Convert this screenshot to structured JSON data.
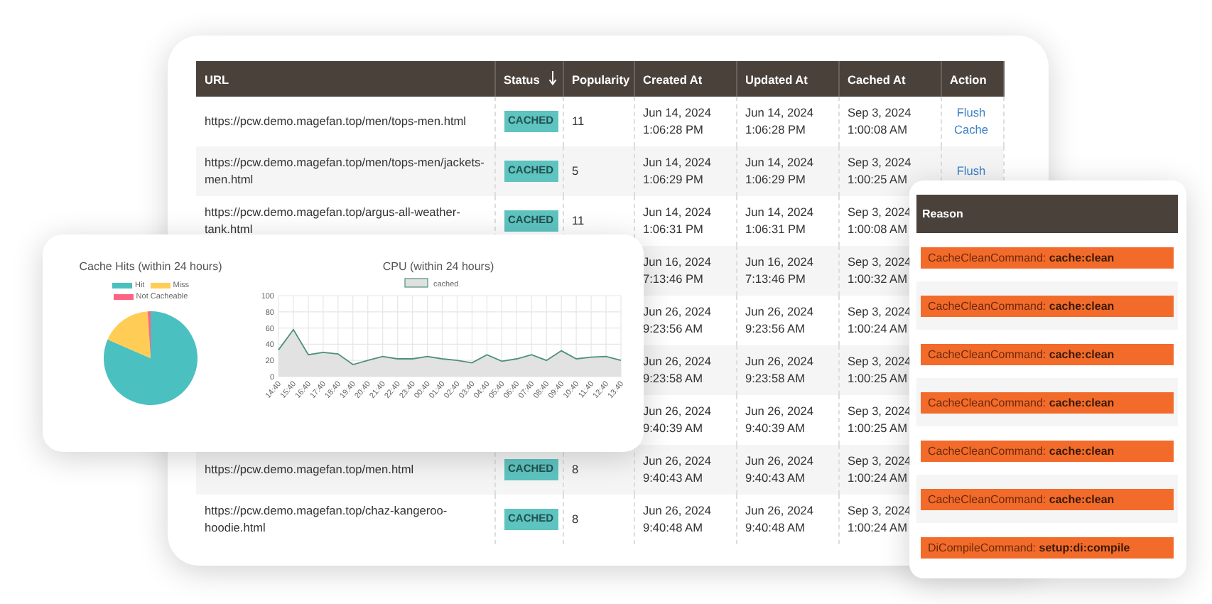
{
  "table": {
    "columns": [
      {
        "label": "URL",
        "sorted": false
      },
      {
        "label": "Status",
        "sorted": true
      },
      {
        "label": "Popularity",
        "sorted": false
      },
      {
        "label": "Created At",
        "sorted": false
      },
      {
        "label": "Updated At",
        "sorted": false
      },
      {
        "label": "Cached At",
        "sorted": false
      },
      {
        "label": "Action",
        "sorted": false
      }
    ],
    "rows": [
      {
        "url": "https://pcw.demo.magefan.top/men/tops-men.html",
        "status": "CACHED",
        "popularity": "11",
        "created_at": "Jun 14, 2024 1:06:28 PM",
        "updated_at": "Jun 14, 2024 1:06:28 PM",
        "cached_at": "Sep 3, 2024 1:00:08 AM",
        "action": "Flush Cache"
      },
      {
        "url": "https://pcw.demo.magefan.top/men/tops-men/jackets-men.html",
        "status": "CACHED",
        "popularity": "5",
        "created_at": "Jun 14, 2024 1:06:29 PM",
        "updated_at": "Jun 14, 2024 1:06:29 PM",
        "cached_at": "Sep 3, 2024 1:00:25 AM",
        "action": "Flush"
      },
      {
        "url": "https://pcw.demo.magefan.top/argus-all-weather-tank.html",
        "status": "CACHED",
        "popularity": "11",
        "created_at": "Jun 14, 2024 1:06:31 PM",
        "updated_at": "Jun 14, 2024 1:06:31 PM",
        "cached_at": "Sep 3, 2024 1:00:08 AM"
      },
      {
        "created_at": "Jun 16, 2024 7:13:46 PM",
        "updated_at": "Jun 16, 2024 7:13:46 PM",
        "cached_at": "Sep 3, 2024 1:00:32 AM"
      },
      {
        "created_at": "Jun 26, 2024 9:23:56 AM",
        "updated_at": "Jun 26, 2024 9:23:56 AM",
        "cached_at": "Sep 3, 2024 1:00:24 AM"
      },
      {
        "created_at": "Jun 26, 2024 9:23:58 AM",
        "updated_at": "Jun 26, 2024 9:23:58 AM",
        "cached_at": "Sep 3, 2024 1:00:25 AM"
      },
      {
        "created_at": "Jun 26, 2024 9:40:39 AM",
        "updated_at": "Jun 26, 2024 9:40:39 AM",
        "cached_at": "Sep 3, 2024 1:00:25 AM"
      },
      {
        "url": "https://pcw.demo.magefan.top/men.html",
        "status": "CACHED",
        "popularity": "8",
        "created_at": "Jun 26, 2024 9:40:43 AM",
        "updated_at": "Jun 26, 2024 9:40:43 AM",
        "cached_at": "Sep 3, 2024 1:00:24 AM"
      },
      {
        "url": "https://pcw.demo.magefan.top/chaz-kangeroo-hoodie.html",
        "status": "CACHED",
        "popularity": "8",
        "created_at": "Jun 26, 2024 9:40:48 AM",
        "updated_at": "Jun 26, 2024 9:40:48 AM",
        "cached_at": "Sep 3, 2024 1:00:24 AM"
      }
    ]
  },
  "cache_hits": {
    "title": "Cache Hits (within 24 hours)",
    "legend": [
      {
        "label": "Hit",
        "color": "#4bc0c0"
      },
      {
        "label": "Miss",
        "color": "#ffcd56"
      },
      {
        "label": "Not Cacheable",
        "color": "#ff6384"
      }
    ]
  },
  "cpu": {
    "title": "CPU (within 24 hours)",
    "chart_data": {
      "type": "area",
      "categories": [
        "14:40",
        "15:40",
        "16:40",
        "17:40",
        "18:40",
        "19:40",
        "20:40",
        "21:40",
        "22:40",
        "23:40",
        "00:40",
        "01:40",
        "02:40",
        "03:40",
        "04:40",
        "05:40",
        "06:40",
        "07:40",
        "08:40",
        "09:40",
        "10:40",
        "11:40",
        "12:40",
        "13:40"
      ],
      "series": [
        {
          "name": "cached",
          "color": "#4e8f7f",
          "values": [
            33,
            58,
            27,
            30,
            28,
            15,
            20,
            25,
            22,
            22,
            25,
            22,
            20,
            17,
            27,
            19,
            22,
            27,
            20,
            32,
            22,
            24,
            25,
            20
          ]
        }
      ],
      "grid": true,
      "ylim": [
        0,
        100
      ],
      "yticks": [
        0,
        20,
        40,
        60,
        80,
        100
      ]
    }
  },
  "reasons": {
    "title": "Reason",
    "items": [
      "CacheCleanCommand: **cache:clean**",
      "CacheCleanCommand: **cache:clean**",
      "CacheCleanCommand: **cache:clean**",
      "CacheCleanCommand: **cache:clean**",
      "CacheCleanCommand: **cache:clean**",
      "CacheCleanCommand: **cache:clean**",
      "DiCompileCommand: **setup:di:compile**"
    ]
  }
}
